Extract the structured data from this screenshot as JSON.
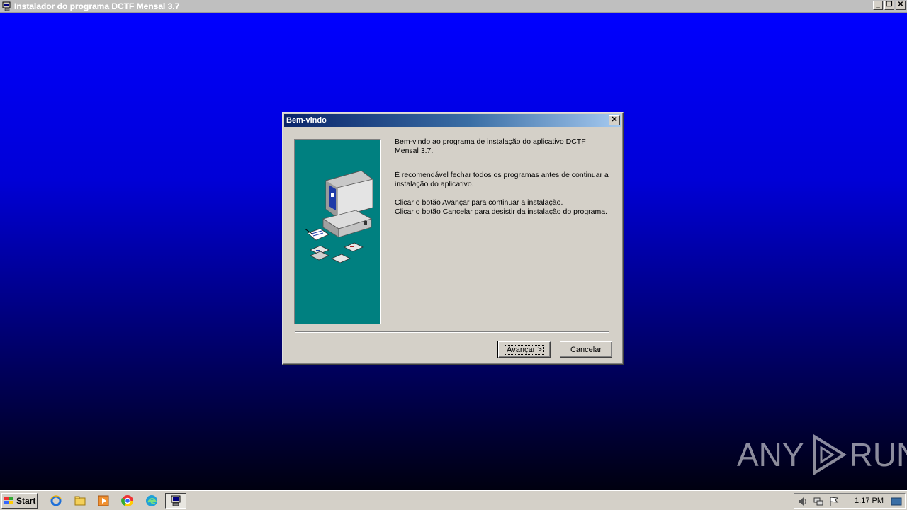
{
  "app_window": {
    "title": "Instalador do programa DCTF Mensal 3.7",
    "controls": [
      "_",
      "❐",
      "✕"
    ]
  },
  "dialog": {
    "title": "Bem-vindo",
    "paragraphs": [
      "Bem-vindo ao programa de instalação do aplicativo DCTF Mensal 3.7.",
      "É recomendável fechar todos os programas antes de continuar a instalação do aplicativo.",
      "Clicar o botão  Avançar para continuar a instalação.",
      "Clicar o botão Cancelar para desistir da instalação do programa."
    ],
    "next_label": "Avançar >",
    "cancel_label": "Cancelar",
    "side_panel_color": "#008080"
  },
  "taskbar": {
    "start_label": "Start",
    "quick_launch": [
      "ie-icon",
      "folder-icon",
      "media-player-icon",
      "chrome-icon",
      "edge-icon"
    ],
    "active_task_icon": "installer-icon",
    "tray_icons": [
      "volume-icon",
      "network-icon",
      "flag-icon",
      "show-desktop-icon"
    ],
    "clock": "1:17 PM"
  },
  "watermark": {
    "left": "ANY",
    "right": "RUN"
  },
  "colors": {
    "desktop_top": "#0000ff",
    "desktop_bottom": "#000010",
    "dialog_title_start": "#0a246a",
    "dialog_title_end": "#a6caf0"
  }
}
